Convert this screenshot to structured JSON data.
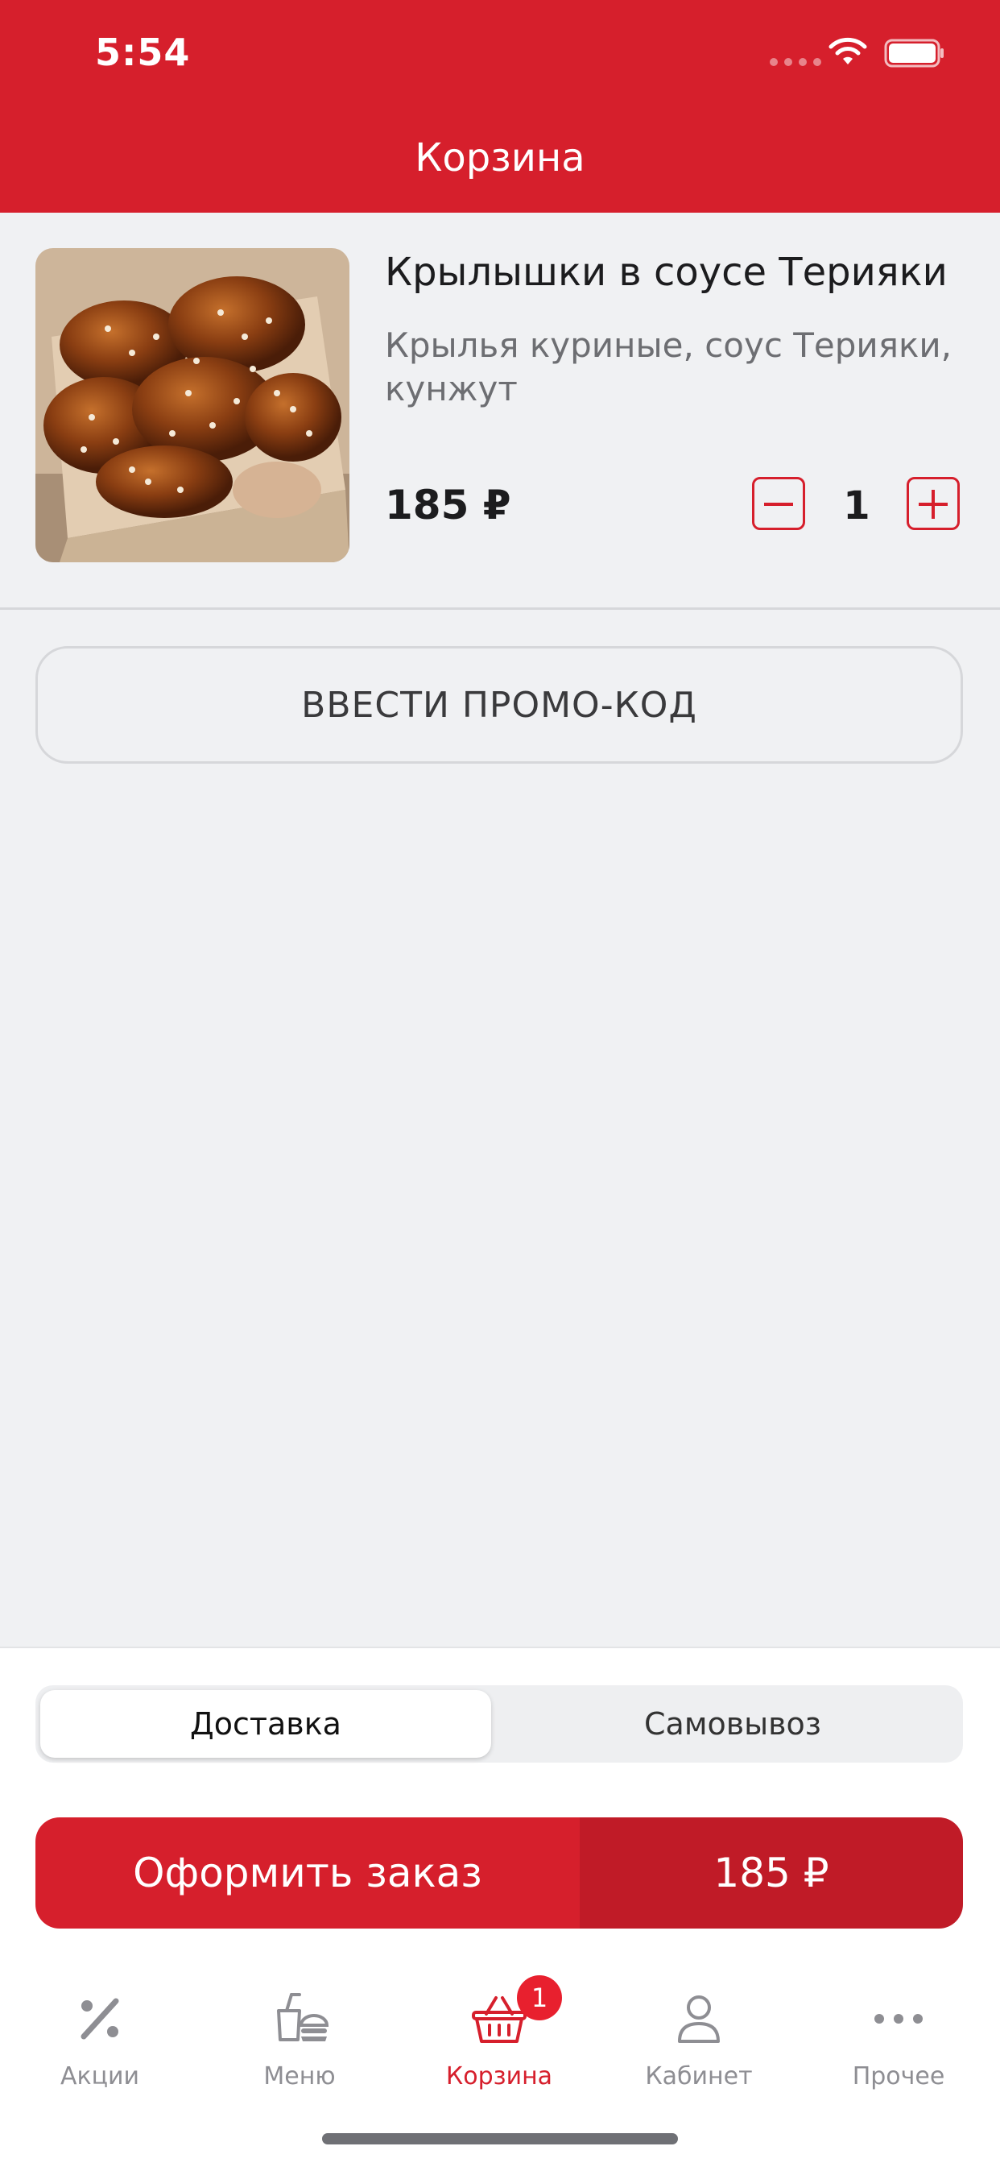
{
  "status_bar": {
    "time": "5:54"
  },
  "header": {
    "title": "Корзина"
  },
  "cart": {
    "items": [
      {
        "name": "Крылышки в соусе Терияки",
        "description": "Крылья куриные, соус Терияки, кунжут",
        "price": "185 ₽",
        "quantity": "1"
      }
    ]
  },
  "promo": {
    "label": "ВВЕСТИ ПРОМО-КОД"
  },
  "delivery_toggle": {
    "options": [
      "Доставка",
      "Самовывоз"
    ],
    "selected": "Доставка"
  },
  "checkout": {
    "label": "Оформить заказ",
    "total": "185 ₽"
  },
  "tab_bar": {
    "tabs": [
      {
        "label": "Акции",
        "icon": "percent-icon"
      },
      {
        "label": "Меню",
        "icon": "menu-food-icon"
      },
      {
        "label": "Корзина",
        "icon": "basket-icon",
        "badge": "1",
        "active": true
      },
      {
        "label": "Кабинет",
        "icon": "user-icon"
      },
      {
        "label": "Прочее",
        "icon": "more-dots-icon"
      }
    ]
  },
  "colors": {
    "accent": "#d61f2c",
    "accent_dark": "#c01b27",
    "background": "#f0f1f3"
  }
}
